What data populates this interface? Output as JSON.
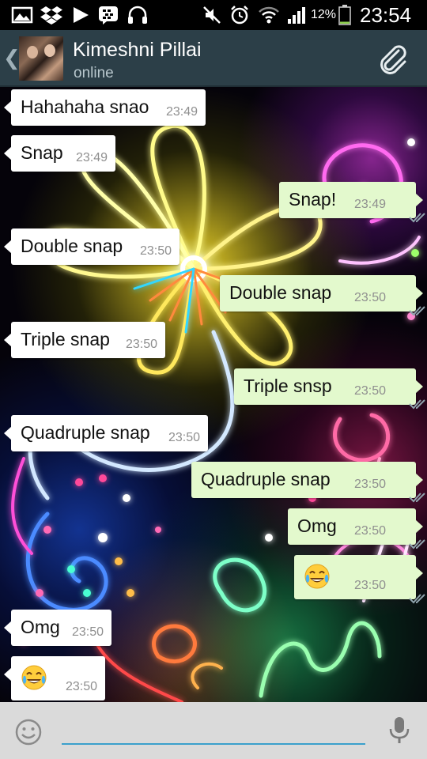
{
  "status_bar": {
    "icons_left": [
      "gallery-icon",
      "dropbox-icon",
      "play-icon",
      "bbm-icon",
      "headphones-icon"
    ],
    "icons_right": [
      "mute-icon",
      "alarm-icon",
      "wifi-icon",
      "signal-icon",
      "battery-icon"
    ],
    "battery_percent": "12%",
    "battery_level": 0.12,
    "time": "23:54"
  },
  "header": {
    "contact_name": "Kimeshni Pillai",
    "contact_status": "online",
    "back_icon": "chevron-left-icon",
    "attach_icon": "paperclip-icon"
  },
  "messages": [
    {
      "dir": "in",
      "text": "Hahahaha snao",
      "time": "23:49"
    },
    {
      "dir": "in",
      "text": "Snap",
      "time": "23:49"
    },
    {
      "dir": "out",
      "text": "Snap!",
      "time": "23:49"
    },
    {
      "dir": "in",
      "text": "Double snap",
      "time": "23:50"
    },
    {
      "dir": "out",
      "text": "Double snap",
      "time": "23:50"
    },
    {
      "dir": "in",
      "text": "Triple snap",
      "time": "23:50"
    },
    {
      "dir": "out",
      "text": "Triple snsp",
      "time": "23:50"
    },
    {
      "dir": "in",
      "text": "Quadruple snap",
      "time": "23:50"
    },
    {
      "dir": "out",
      "text": "Quadruple snap",
      "time": "23:50"
    },
    {
      "dir": "out",
      "text": "Omg",
      "time": "23:50"
    },
    {
      "dir": "out",
      "text": "😂",
      "time": "23:50"
    },
    {
      "dir": "in",
      "text": "Omg",
      "time": "23:50"
    },
    {
      "dir": "in",
      "text": "😂",
      "time": "23:50"
    }
  ],
  "input_bar": {
    "placeholder": "",
    "value": "",
    "emoji_icon": "smiley-icon",
    "mic_icon": "microphone-icon"
  },
  "colors": {
    "header_bg": "#2c3f48",
    "incoming_bubble": "#ffffff",
    "outgoing_bubble": "#e3f9cd",
    "input_underline": "#3aa0cc",
    "ticks": "#8fa3ad"
  }
}
